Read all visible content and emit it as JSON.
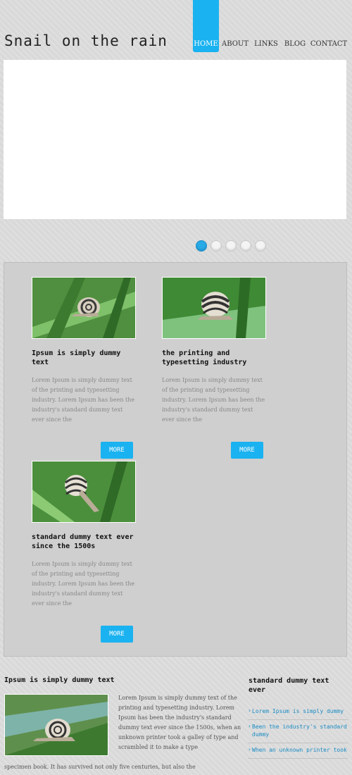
{
  "header": {
    "site_title": "Snail on the rain",
    "nav": [
      {
        "label": "HOME",
        "active": true
      },
      {
        "label": "ABOUT"
      },
      {
        "label": "LINKS"
      },
      {
        "label": "BLOG"
      },
      {
        "label": "CONTACT"
      }
    ]
  },
  "slider": {
    "dot_count": 5,
    "active_dot": 1
  },
  "features": {
    "cards": [
      {
        "title": "Ipsum is simply dummy text",
        "text": "Lorem Ipsum is simply dummy text of the printing and typesetting industry. Lorem Ipsum has been the industry's standard dummy text ever since the",
        "button": "MORE"
      },
      {
        "title": "the printing and typesetting industry",
        "text": "Lorem Ipsum is simply dummy text of the printing and typesetting industry. Lorem Ipsum has been the industry's standard dummy text ever since the",
        "button": "MORE"
      },
      {
        "title": "standard dummy text ever since the 1500s",
        "text": "Lorem Ipsum is simply dummy text of the printing and typesetting industry. Lorem Ipsum has been the industry's standard dummy text ever since the",
        "button": "MORE"
      }
    ]
  },
  "main": {
    "title": "Ipsum is simply dummy text",
    "text": "Lorem Ipsum is simply dummy text of the printing and typesetting industry. Lorem Ipsum has been the industry's standard dummy text ever since the 1500s, when an unknown printer took a galley of type and scrambled it to make a type",
    "text_continued": "specimen book. It has survived not only five centuries, but also the"
  },
  "sidebar": {
    "title": "standard dummy text ever",
    "links": [
      "Lorem Ipsum is simply dummy",
      "Been the industry's standard dummy",
      "When an unknown printer took"
    ]
  },
  "colors": {
    "accent": "#1ab2f0",
    "background": "#d9d9d9",
    "panel": "#cfcfcf"
  }
}
